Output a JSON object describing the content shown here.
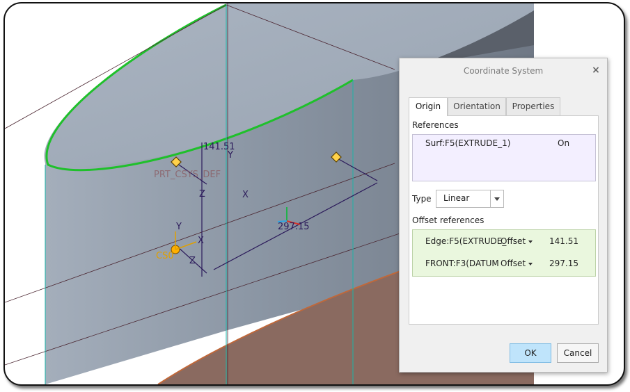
{
  "viewport": {
    "dimensions": [
      {
        "value": "141.51"
      },
      {
        "value": "297.15"
      }
    ],
    "axis_labels": {
      "y_top": "Y",
      "z": "Z",
      "x": "X",
      "y_cs": "Y",
      "x_cs": "X",
      "z_cs": "Z"
    },
    "csys_name": "PRT_CSYS_DEF",
    "new_csys_name": "CS0",
    "colors": {
      "surface": "#8d97a5",
      "highlight_edge": "#1fc02b",
      "datum_plane": "#b0653f",
      "dimension": "#2b1a5a"
    }
  },
  "dialog": {
    "title": "Coordinate System",
    "close_icon": "close-icon",
    "tabs": [
      "Origin",
      "Orientation",
      "Properties"
    ],
    "active_tab": "Origin",
    "references_label": "References",
    "references": [
      {
        "name": "Surf:F5(EXTRUDE_1)",
        "constraint": "On"
      }
    ],
    "type_label": "Type",
    "type_value": "Linear",
    "offset_label": "Offset references",
    "offsets": [
      {
        "ref": "Edge:F5(EXTRUDE_",
        "type": "Offset",
        "value": "141.51"
      },
      {
        "ref": "FRONT:F3(DATUM",
        "type": "Offset",
        "value": "297.15"
      }
    ],
    "ok_label": "OK",
    "cancel_label": "Cancel"
  }
}
